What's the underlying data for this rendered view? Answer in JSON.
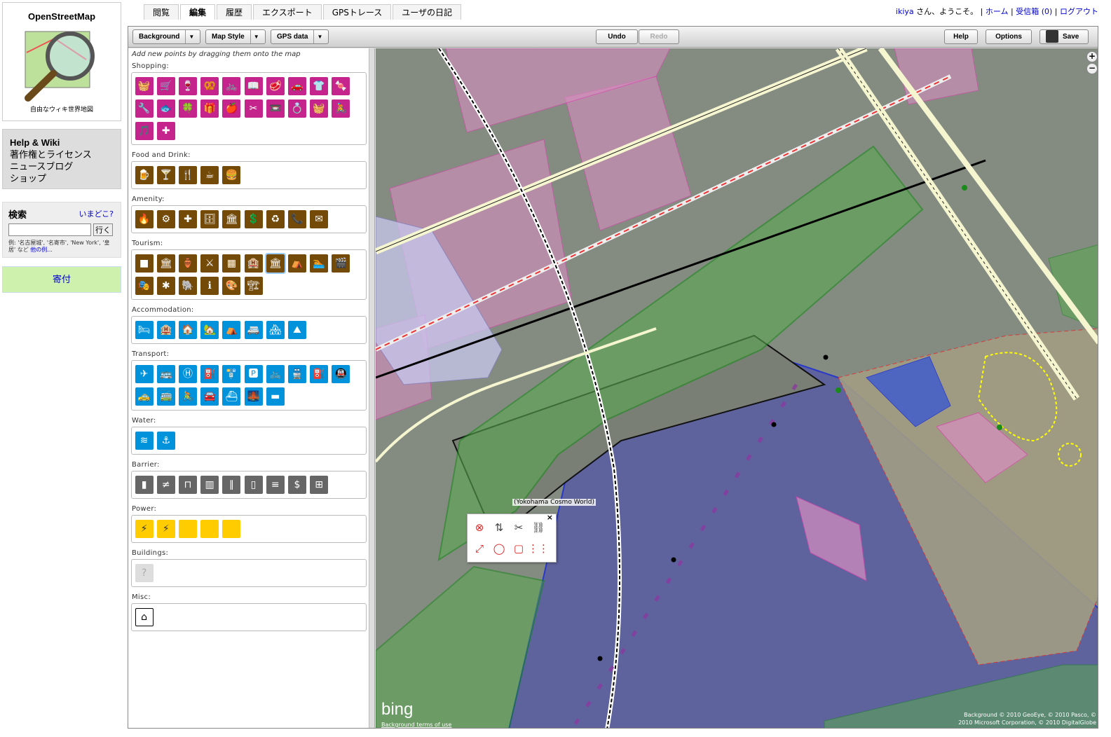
{
  "sidebar": {
    "logo_title": "OpenStreetMap",
    "logo_sub": "自由なウィキ世界地図",
    "help_links": [
      "Help & Wiki",
      "著作権とライセンス",
      "ニュースブログ",
      "ショップ"
    ],
    "search_title": "検索",
    "where_link": "いまどこ?",
    "search_value": "",
    "search_go": "行く",
    "search_hint": "例: '名古屋城', '名寄市', 'New York', '皇居' など",
    "search_more": "他の例...",
    "donate": "寄付"
  },
  "tabs": [
    "閲覧",
    "編集",
    "履歴",
    "エクスポート",
    "GPSトレース",
    "ユーザの日記"
  ],
  "active_tab": "編集",
  "user": {
    "name": "ikiya",
    "greeting": "さん、ようこそ。",
    "home": "ホーム",
    "inbox": "受信箱 (0)",
    "logout": "ログアウト"
  },
  "toolbar": {
    "background": "Background",
    "map_style": "Map Style",
    "gps_data": "GPS data",
    "undo": "Undo",
    "redo": "Redo",
    "help": "Help",
    "options": "Options",
    "save": "Save"
  },
  "palette": {
    "hint": "Add new points by dragging them onto the map",
    "categories": [
      {
        "title": "Shopping:",
        "kind": "shopping",
        "icons": [
          "🧺",
          "🛒",
          "🍷",
          "🥨",
          "🚲",
          "📖",
          "🥩",
          "🚗",
          "👕",
          "🍬",
          "🔧",
          "🐟",
          "🍀",
          "🎁",
          "🍎",
          "✂",
          "📼",
          "💍",
          "🧺",
          "🚴",
          "🎵",
          "✚"
        ]
      },
      {
        "title": "Food and Drink:",
        "kind": "food",
        "icons": [
          "🍺",
          "🍸",
          "🍴",
          "☕",
          "🍔"
        ]
      },
      {
        "title": "Amenity:",
        "kind": "amenity",
        "icons": [
          "🔥",
          "⚙",
          "✚",
          "🗄",
          "🏛",
          "💲",
          "♻",
          "📞",
          "✉"
        ]
      },
      {
        "title": "Tourism:",
        "kind": "tourism",
        "icons": [
          "■",
          "🏛",
          "🏺",
          "⚔",
          "▦",
          "🏨",
          "🏛",
          "⛺",
          "🏊",
          "🎬",
          "🎭",
          "✱",
          "🐘",
          "ℹ",
          "🎨",
          "🏗"
        ]
      },
      {
        "title": "Accommodation:",
        "kind": "acc",
        "icons": [
          "🛏",
          "🏨",
          "🏠",
          "🏡",
          "⛺",
          "🚐",
          "🏘",
          "⛰"
        ]
      },
      {
        "title": "Transport:",
        "kind": "transport",
        "icons": [
          "✈",
          "🚌",
          "Ⓗ",
          "⛽",
          "🚏",
          "🅿",
          "🚲",
          "🚆",
          "⛽",
          "🚇",
          "🚕",
          "🚎",
          "🚴",
          "🚘",
          "⛴",
          "🌉",
          "▬"
        ]
      },
      {
        "title": "Water:",
        "kind": "water",
        "icons": [
          "≋",
          "⚓"
        ]
      },
      {
        "title": "Barrier:",
        "kind": "barrier",
        "icons": [
          "▮",
          "≠",
          "⊓",
          "▥",
          "∥",
          "▯",
          "≡",
          "$",
          "⊞"
        ]
      },
      {
        "title": "Power:",
        "kind": "power",
        "icons": [
          "⚡",
          "⚡",
          "",
          "",
          ""
        ]
      },
      {
        "title": "Buildings:",
        "kind": "buildings",
        "icons": [
          "?"
        ]
      },
      {
        "title": "Misc:",
        "kind": "misc",
        "icons": [
          "⌂"
        ]
      }
    ]
  },
  "map": {
    "tooltip": "(Yokohama Cosmo World)",
    "bing": "bing",
    "terms": "Background terms of use",
    "attribution_1": "Background © 2010 GeoEye, © 2010 Pasco, ©",
    "attribution_2": "2010 Microsoft Corporation, © 2010 DigitalGlobe",
    "popup_icons": [
      "⊗",
      "⇅",
      "✂",
      "⛓",
      "⤢",
      "◯",
      "▢",
      "⋮⋮"
    ]
  }
}
